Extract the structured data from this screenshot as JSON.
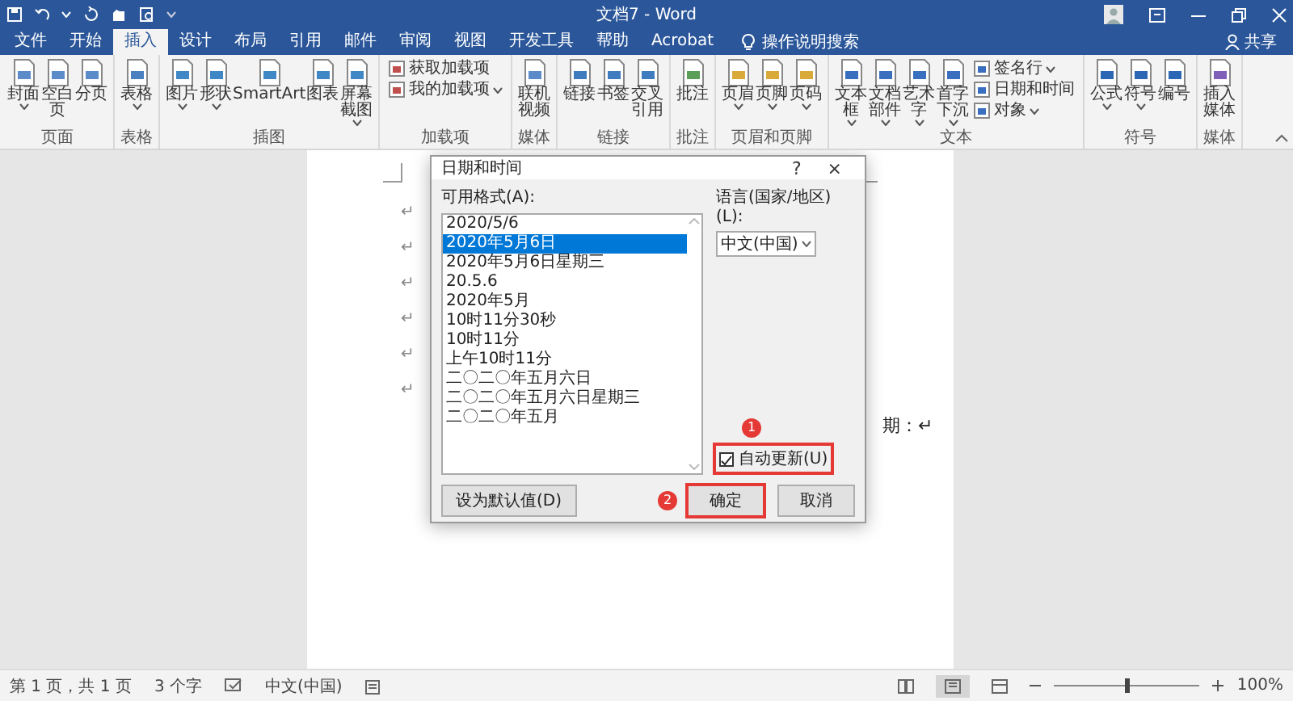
{
  "window": {
    "title": "文档7 - Word"
  },
  "tabs": [
    {
      "label": "文件",
      "selected": false
    },
    {
      "label": "开始",
      "selected": false
    },
    {
      "label": "插入",
      "selected": true
    },
    {
      "label": "设计",
      "selected": false
    },
    {
      "label": "布局",
      "selected": false
    },
    {
      "label": "引用",
      "selected": false
    },
    {
      "label": "邮件",
      "selected": false
    },
    {
      "label": "审阅",
      "selected": false
    },
    {
      "label": "视图",
      "selected": false
    },
    {
      "label": "开发工具",
      "selected": false
    },
    {
      "label": "帮助",
      "selected": false
    },
    {
      "label": "Acrobat",
      "selected": false
    }
  ],
  "tell_me": "操作说明搜索",
  "share": "共享",
  "ribbon": {
    "groups": [
      {
        "label": "页面",
        "items": [
          {
            "kind": "large",
            "label": "封面",
            "menu": true
          },
          {
            "kind": "large",
            "label": "空白页",
            "menu": false
          },
          {
            "kind": "large",
            "label": "分页",
            "menu": false
          }
        ]
      },
      {
        "label": "表格",
        "items": [
          {
            "kind": "large",
            "label": "表格",
            "menu": true
          }
        ]
      },
      {
        "label": "插图",
        "items": [
          {
            "kind": "large",
            "label": "图片",
            "menu": true
          },
          {
            "kind": "large",
            "label": "形状",
            "menu": true
          },
          {
            "kind": "large",
            "label": "SmartArt",
            "menu": false
          },
          {
            "kind": "large",
            "label": "图表",
            "menu": false
          },
          {
            "kind": "large",
            "label": "屏幕截图",
            "menu": true
          }
        ]
      },
      {
        "label": "加载项",
        "items": [
          {
            "kind": "small",
            "label": "获取加载项",
            "menu": false
          },
          {
            "kind": "small",
            "label": "我的加载项",
            "menu": true
          }
        ]
      },
      {
        "label": "媒体",
        "items": [
          {
            "kind": "large",
            "label": "联机视频",
            "menu": false
          }
        ]
      },
      {
        "label": "链接",
        "items": [
          {
            "kind": "large",
            "label": "链接",
            "menu": false
          },
          {
            "kind": "large",
            "label": "书签",
            "menu": false
          },
          {
            "kind": "large",
            "label": "交叉引用",
            "menu": false
          }
        ]
      },
      {
        "label": "批注",
        "items": [
          {
            "kind": "large",
            "label": "批注",
            "menu": false
          }
        ]
      },
      {
        "label": "页眉和页脚",
        "items": [
          {
            "kind": "large",
            "label": "页眉",
            "menu": true
          },
          {
            "kind": "large",
            "label": "页脚",
            "menu": true
          },
          {
            "kind": "large",
            "label": "页码",
            "menu": true
          }
        ]
      },
      {
        "label": "文本",
        "items": [
          {
            "kind": "large",
            "label": "文本框",
            "menu": true
          },
          {
            "kind": "large",
            "label": "文档部件",
            "menu": true
          },
          {
            "kind": "large",
            "label": "艺术字",
            "menu": true
          },
          {
            "kind": "large",
            "label": "首字下沉",
            "menu": true
          },
          {
            "kind": "small",
            "label": "签名行",
            "menu": true
          },
          {
            "kind": "small",
            "label": "日期和时间",
            "menu": false
          },
          {
            "kind": "small",
            "label": "对象",
            "menu": true
          }
        ]
      },
      {
        "label": "符号",
        "items": [
          {
            "kind": "large",
            "label": "公式",
            "menu": true
          },
          {
            "kind": "large",
            "label": "符号",
            "menu": true
          },
          {
            "kind": "large",
            "label": "编号",
            "menu": false
          }
        ]
      },
      {
        "label": "媒体",
        "items": [
          {
            "kind": "large",
            "label": "插入媒体",
            "menu": false
          }
        ]
      }
    ]
  },
  "document": {
    "lines": [
      {
        "kind": "mark",
        "text": "↵"
      },
      {
        "kind": "mark",
        "text": "↵"
      },
      {
        "kind": "mark",
        "text": "↵"
      },
      {
        "kind": "mark",
        "text": "↵"
      },
      {
        "kind": "mark",
        "text": "↵"
      },
      {
        "kind": "mark",
        "text": "↵"
      },
      {
        "kind": "tail",
        "text": "期：↵"
      }
    ]
  },
  "dialog": {
    "title": "日期和时间",
    "help": "?",
    "close": "×",
    "formats_label": "可用格式(A):",
    "formats": [
      {
        "text": "2020/5/6",
        "selected": false
      },
      {
        "text": "2020年5月6日",
        "selected": true
      },
      {
        "text": "2020年5月6日星期三",
        "selected": false
      },
      {
        "text": "20.5.6",
        "selected": false
      },
      {
        "text": "2020年5月",
        "selected": false
      },
      {
        "text": "10时11分30秒",
        "selected": false
      },
      {
        "text": "10时11分",
        "selected": false
      },
      {
        "text": "上午10时11分",
        "selected": false
      },
      {
        "text": "二〇二〇年五月六日",
        "selected": false
      },
      {
        "text": "二〇二〇年五月六日星期三",
        "selected": false
      },
      {
        "text": "二〇二〇年五月",
        "selected": false
      }
    ],
    "language_label": "语言(国家/地区)(L):",
    "language": "中文(中国)",
    "auto_update": {
      "label": "自动更新(U)",
      "checked": true,
      "highlighted": true,
      "callout": "1"
    },
    "buttons": [
      {
        "kind": "default",
        "label": "设为默认值(D)",
        "highlighted": false
      },
      {
        "kind": "ok",
        "label": "确定",
        "highlighted": true,
        "callout": "2"
      },
      {
        "kind": "cancel",
        "label": "取消",
        "highlighted": false
      }
    ]
  },
  "status_bar": {
    "page": "第 1 页，共 1 页",
    "words": "3 个字",
    "language": "中文(中国)",
    "views": [
      {
        "selected": false
      },
      {
        "selected": true
      },
      {
        "selected": false
      }
    ],
    "zoom_slider": {
      "level": 0.5
    },
    "zoom": "100%"
  }
}
